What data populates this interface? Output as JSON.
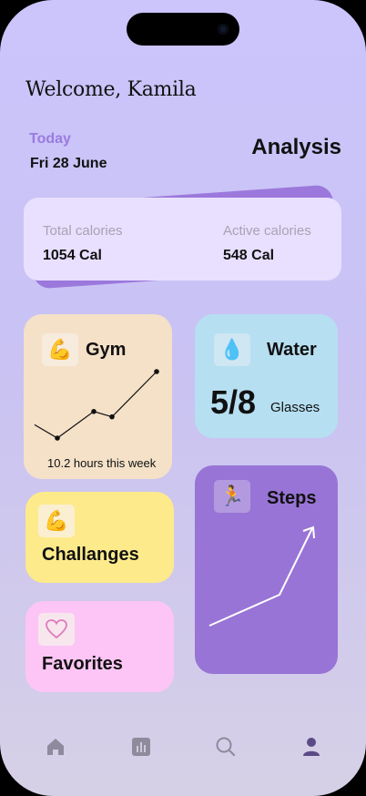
{
  "greeting": "Welcome, Kamila",
  "today_label": "Today",
  "date": "Fri 28 June",
  "section_title": "Analysis",
  "calories": {
    "total_label": "Total calories",
    "total_value": "1054 Cal",
    "active_label": "Active calories",
    "active_value": "548 Cal"
  },
  "gym": {
    "icon": "flexed-biceps-icon",
    "title": "Gym",
    "note": "10.2 hours this week",
    "trend": [
      2,
      1,
      3,
      2.6,
      6
    ]
  },
  "water": {
    "icon": "droplet-icon",
    "title": "Water",
    "value": "5/8",
    "unit": "Glasses"
  },
  "challenges": {
    "icon": "flexed-biceps-icon",
    "title": "Challanges"
  },
  "favorites": {
    "icon": "heart-icon",
    "title": "Favorites"
  },
  "steps": {
    "icon": "person-running-icon",
    "title": "Steps"
  },
  "tabs": [
    "home",
    "stats",
    "search",
    "profile"
  ],
  "colors": {
    "accent": "#9874d6",
    "today": "#9a7be0",
    "tab_inactive": "#8f8a9c",
    "tab_active": "#5b4a86"
  }
}
